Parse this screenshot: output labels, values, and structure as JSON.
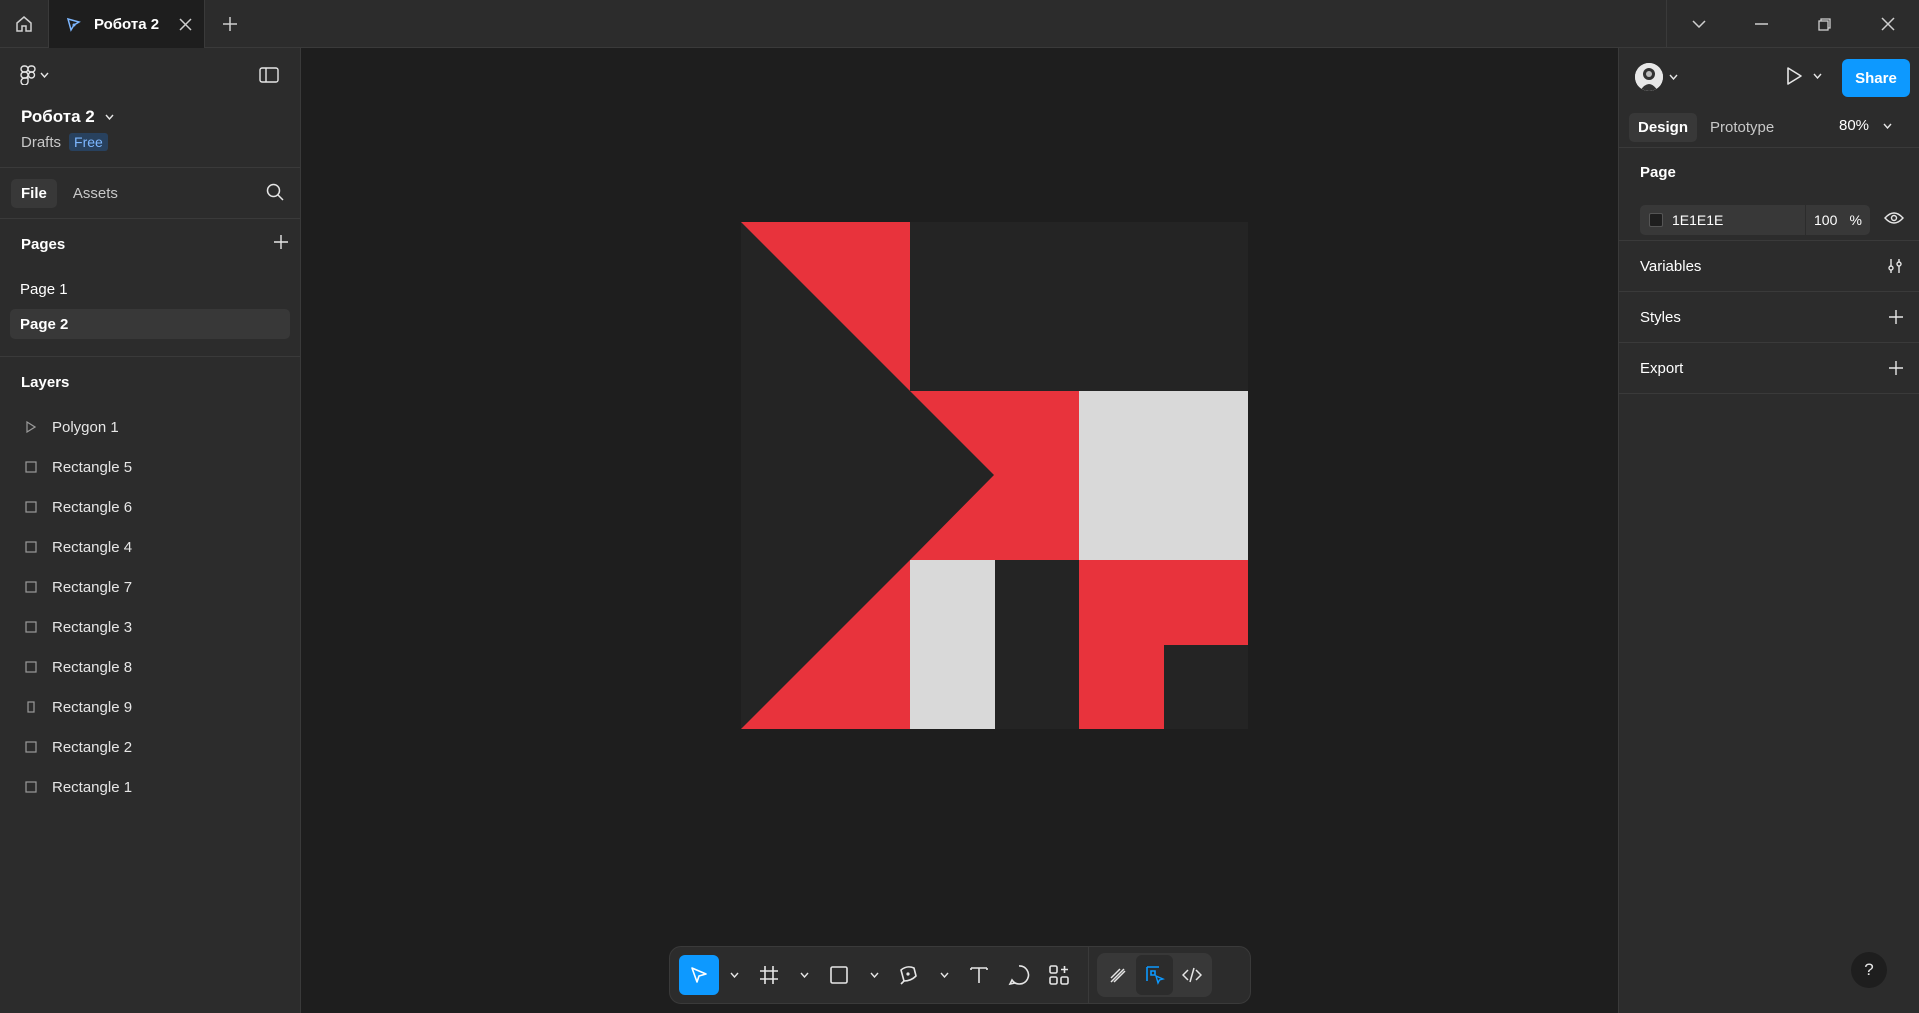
{
  "titlebar": {
    "tab_label": "Робота 2"
  },
  "left_panel": {
    "file_title": "Робота 2",
    "location": "Drafts",
    "plan_badge": "Free",
    "tabs": [
      "File",
      "Assets"
    ],
    "pages_header": "Pages",
    "pages": [
      {
        "label": "Page 1",
        "active": false
      },
      {
        "label": "Page 2",
        "active": true
      }
    ],
    "layers_header": "Layers",
    "layers": [
      {
        "label": "Polygon 1",
        "icon": "polygon-icon"
      },
      {
        "label": "Rectangle 5",
        "icon": "rectangle-icon"
      },
      {
        "label": "Rectangle 6",
        "icon": "rectangle-icon"
      },
      {
        "label": "Rectangle 4",
        "icon": "rectangle-icon"
      },
      {
        "label": "Rectangle 7",
        "icon": "rectangle-icon"
      },
      {
        "label": "Rectangle 3",
        "icon": "rectangle-icon"
      },
      {
        "label": "Rectangle 8",
        "icon": "rectangle-icon"
      },
      {
        "label": "Rectangle 9",
        "icon": "rectangle-icon"
      },
      {
        "label": "Rectangle 2",
        "icon": "rectangle-icon"
      },
      {
        "label": "Rectangle 1",
        "icon": "rectangle-icon"
      }
    ]
  },
  "right_panel": {
    "share_label": "Share",
    "tabs": [
      "Design",
      "Prototype"
    ],
    "zoom": "80%",
    "page_section": "Page",
    "page_fill_hex": "1E1E1E",
    "page_fill_opacity": "100",
    "page_fill_unit": "%",
    "variables_label": "Variables",
    "styles_label": "Styles",
    "export_label": "Export",
    "help_label": "?"
  },
  "colors": {
    "accent": "#0d99ff",
    "red": "#e8333c",
    "light": "#d9d9d9",
    "artboard": "#242424",
    "canvas": "#1e1e1e"
  }
}
